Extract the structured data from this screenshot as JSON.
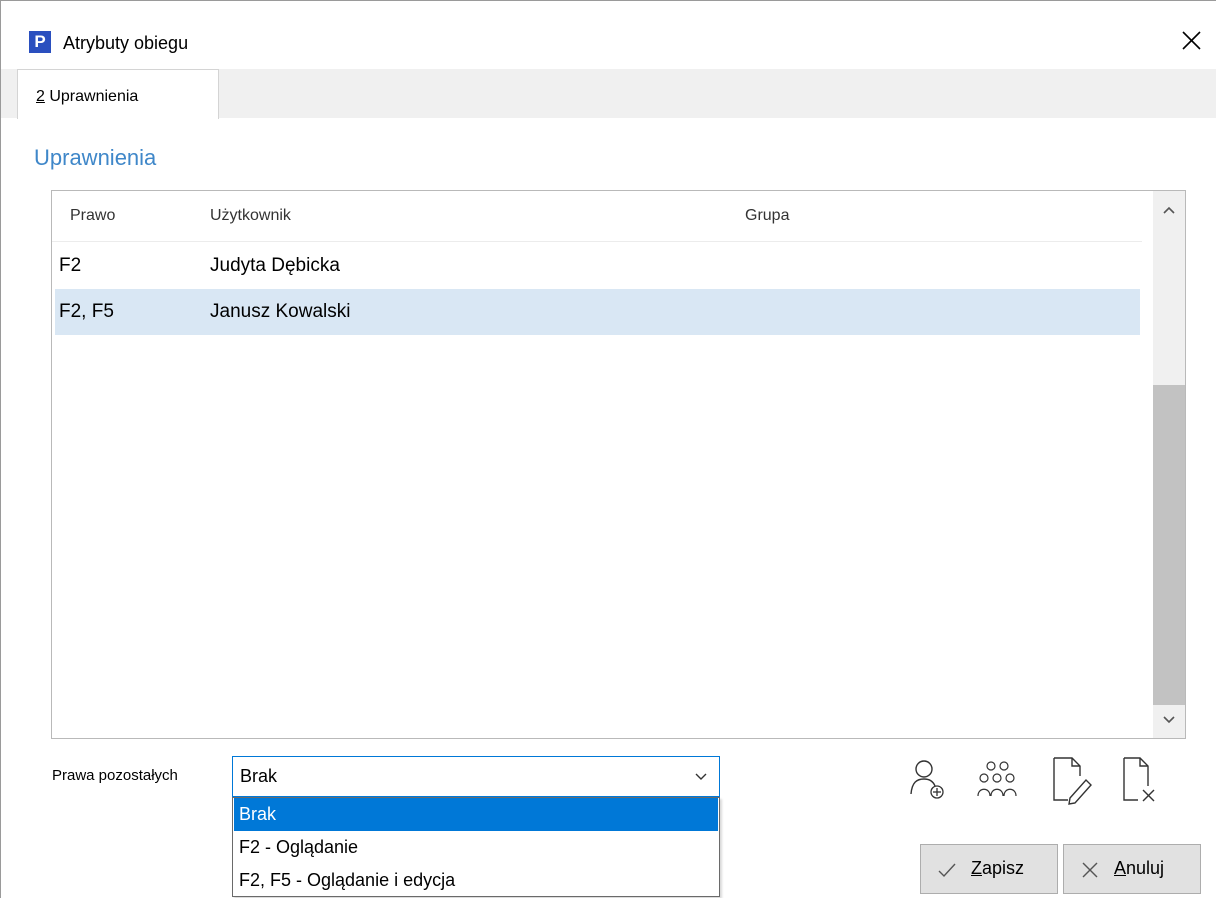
{
  "window": {
    "app_icon_letter": "P",
    "title": "Atrybuty obiegu",
    "close_icon": "close-icon"
  },
  "tabs": [
    {
      "mnemonic": "2",
      "label": " Uprawnienia",
      "active": true
    }
  ],
  "section_title": "Uprawnienia",
  "permissions_table": {
    "columns": [
      "Prawo",
      "Użytkownik",
      "Grupa"
    ],
    "rows": [
      {
        "prawo": "F2",
        "uzytkownik": "Judyta Dębicka",
        "grupa": "",
        "selected": false
      },
      {
        "prawo": "F2, F5",
        "uzytkownik": "Janusz Kowalski",
        "grupa": "",
        "selected": true
      }
    ],
    "selected_row_color": "#d9e7f4"
  },
  "others_rights": {
    "label": "Prawa pozostałych",
    "value": "Brak",
    "options": [
      {
        "label": "Brak",
        "highlighted": true
      },
      {
        "label": "F2 - Oglądanie",
        "highlighted": false
      },
      {
        "label": "F2, F5 - Oglądanie i edycja",
        "highlighted": false
      }
    ],
    "highlight_color": "#0078d7"
  },
  "toolbar": {
    "icons": [
      "add-user-icon",
      "add-group-icon",
      "edit-document-icon",
      "delete-document-icon"
    ]
  },
  "buttons": {
    "save": {
      "mnemonic": "Z",
      "rest": "apisz",
      "icon": "check-icon"
    },
    "cancel": {
      "mnemonic": "A",
      "rest": "nuluj",
      "icon": "x-icon"
    }
  },
  "colors": {
    "accent": "#0078d7",
    "section_title": "#3f87c9",
    "app_icon": "#2a4fbf"
  }
}
